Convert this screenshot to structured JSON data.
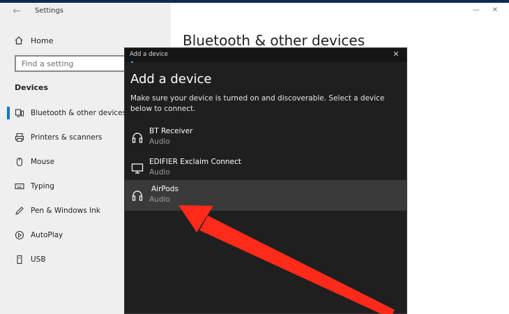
{
  "settings": {
    "title": "Settings",
    "back_icon": "back-arrow-icon",
    "minimize": "—",
    "close": "✕",
    "home_label": "Home",
    "search_placeholder": "Find a setting",
    "section": "Devices",
    "nav": [
      {
        "label": "Bluetooth & other devices",
        "icon": "bluetooth-devices-icon",
        "selected": true
      },
      {
        "label": "Printers & scanners",
        "icon": "printer-icon"
      },
      {
        "label": "Mouse",
        "icon": "mouse-icon"
      },
      {
        "label": "Typing",
        "icon": "keyboard-icon"
      },
      {
        "label": "Pen & Windows Ink",
        "icon": "pen-icon"
      },
      {
        "label": "AutoPlay",
        "icon": "autoplay-icon"
      },
      {
        "label": "USB",
        "icon": "usb-icon"
      }
    ],
    "page_heading": "Bluetooth & other devices"
  },
  "dialog": {
    "title": "Add a device",
    "close": "✕",
    "heading": "Add a device",
    "description": "Make sure your device is turned on and discoverable. Select a device below to connect.",
    "devices": [
      {
        "name": "BT Receiver",
        "type": "Audio",
        "icon": "headphones-icon"
      },
      {
        "name": "EDIFIER Exclaim Connect",
        "type": "Audio",
        "icon": "monitor-icon"
      },
      {
        "name": "AirPods",
        "type": "Audio",
        "icon": "headphones-icon",
        "selected": true
      }
    ]
  },
  "colors": {
    "accent": "#0078d7",
    "dialog_bg": "#1f1f1f",
    "selected_row": "#3a3a3a",
    "annotation_arrow": "#ff2a1a"
  }
}
